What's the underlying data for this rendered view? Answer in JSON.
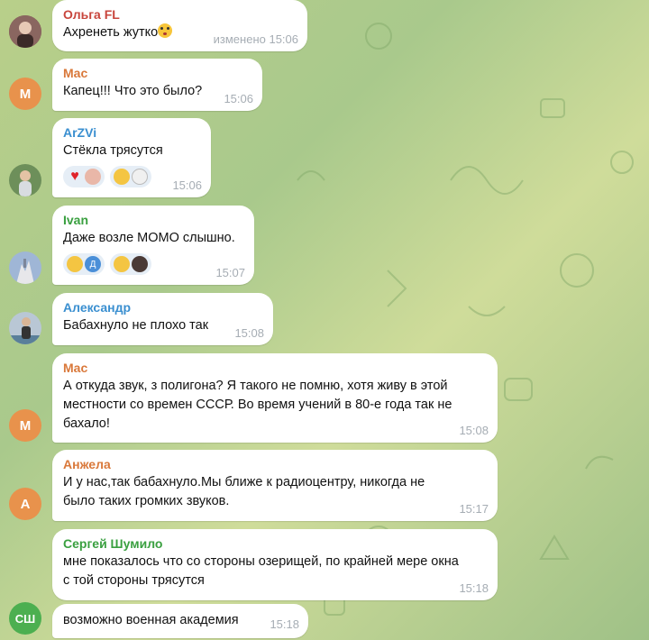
{
  "colors": {
    "accent_blue": "#3a8fd0",
    "mac_orange": "#d9783a",
    "anzhela_orange": "#d9783a",
    "sergey_green": "#3aa040",
    "ivan_green": "#3aa040",
    "olga_red": "#c8453c"
  },
  "messages": [
    {
      "sender": "Ольга FL",
      "text": "Ахренеть жутко",
      "emoji": "flushed-face",
      "time": "изменено 15:06"
    },
    {
      "sender": "Mac",
      "avatar_initials": "M",
      "text": "Капец!!! Что это было?",
      "time": "15:06"
    },
    {
      "sender": "ArZVi",
      "text": "Стёкла трясутся",
      "time": "15:06",
      "reactions": [
        "red-heart",
        "hand-avatar",
        "screaming-face",
        "white-figure-avatar"
      ]
    },
    {
      "sender": "Ivan",
      "text": "Даже возле МОМО слышно.",
      "time": "15:07",
      "reactions": [
        "thumbs-up",
        "Д",
        "screaming-face",
        "dark-avatar"
      ]
    },
    {
      "sender": "Александр",
      "text": "Бабахнуло не плохо так",
      "time": "15:08"
    },
    {
      "sender": "Mac",
      "avatar_initials": "M",
      "text": "А откуда звук, з полигона? Я такого не помню, хотя живу в этой местности со времен СССР. Во время учений в 80-е года так не бахало!",
      "time": "15:08"
    },
    {
      "sender": "Анжела",
      "avatar_initials": "A",
      "text": "И у нас,так бабахнуло.Мы ближе к радиоцентру, никогда не было таких громких звуков.",
      "time": "15:17"
    },
    {
      "sender": "Сергей Шумило",
      "text": "мне показалось что со стороны озерищей, по крайней мере окна с той стороны трясутся",
      "time": "15:18"
    },
    {
      "sender": "",
      "avatar_initials": "СШ",
      "text": "возможно военная академия",
      "time": "15:18"
    }
  ]
}
